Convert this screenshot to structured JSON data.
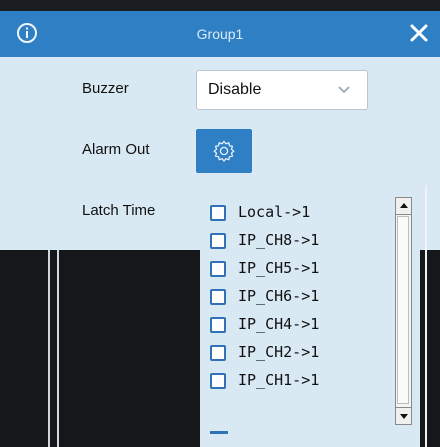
{
  "titlebar": {
    "title": "Group1",
    "info_icon": "info-icon",
    "close_icon": "close-icon"
  },
  "form": {
    "buzzer_label": "Buzzer",
    "buzzer_value": "Disable",
    "alarm_out_label": "Alarm Out",
    "alarm_out_icon": "gear-icon",
    "latch_time_label": "Latch Time"
  },
  "channels": [
    {
      "label": "Local->1",
      "checked": false
    },
    {
      "label": "IP_CH8->1",
      "checked": false
    },
    {
      "label": "IP_CH5->1",
      "checked": false
    },
    {
      "label": "IP_CH6->1",
      "checked": false
    },
    {
      "label": "IP_CH4->1",
      "checked": false
    },
    {
      "label": "IP_CH2->1",
      "checked": false
    },
    {
      "label": "IP_CH1->1",
      "checked": false
    }
  ],
  "colors": {
    "accent": "#2e7fc4",
    "panel": "#d9e9f3",
    "checkbox_border": "#2f72b8"
  }
}
